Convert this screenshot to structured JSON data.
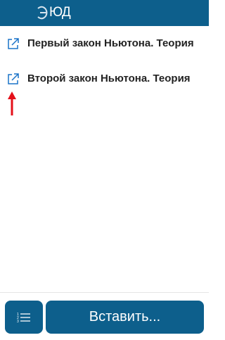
{
  "header": {
    "logo_text": "ЮД",
    "logo_letter": "Э",
    "background": "#0d5f8c"
  },
  "items": [
    {
      "label": "Первый закон Ньютона. Теория",
      "icon": "external-link-icon"
    },
    {
      "label": "Второй закон Ньютона. Теория",
      "icon": "external-link-icon"
    }
  ],
  "annotation": {
    "icon": "red-up-arrow",
    "color": "#e4101a"
  },
  "footer": {
    "list_button_icon": "numbered-list-icon",
    "insert_label": "Вставить...",
    "button_color": "#0d5f8c"
  }
}
